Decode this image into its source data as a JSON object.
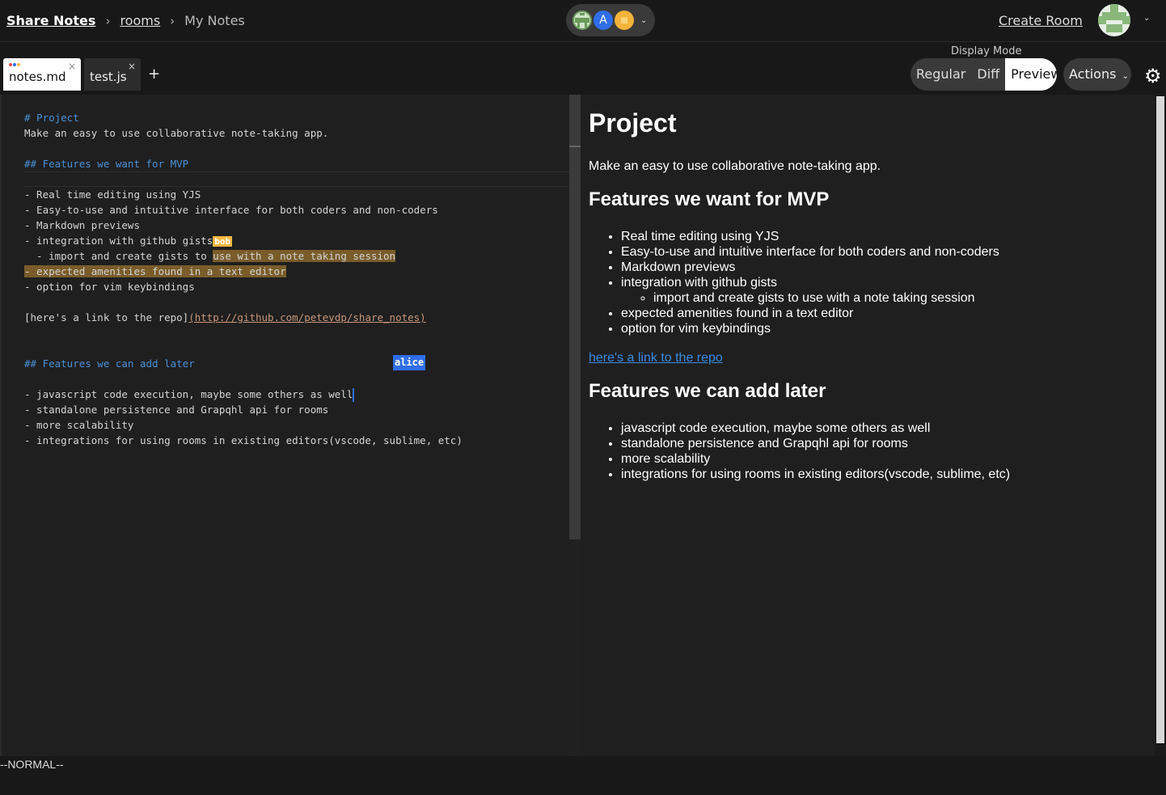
{
  "breadcrumb": {
    "home": "Share Notes",
    "rooms": "rooms",
    "current": "My Notes",
    "sep": "›"
  },
  "users": {
    "avatar_a": "A",
    "chevron": "⌄"
  },
  "header": {
    "create_room": "Create Room",
    "profile_chevron": "⌄"
  },
  "tabs": [
    {
      "label": "notes.md",
      "close": "×",
      "active": true
    },
    {
      "label": "test.js",
      "close": "×",
      "active": false
    }
  ],
  "add_tab": "+",
  "display_mode": {
    "label": "Display Mode",
    "options": [
      "Regular",
      "Diff",
      "Preview"
    ],
    "selected": "Preview"
  },
  "actions": {
    "label": "Actions",
    "chevron": "⌄"
  },
  "editor": {
    "lines": {
      "l1": "# Project",
      "l2": "Make an easy to use collaborative note-taking app.",
      "l4": "## Features we want for MVP",
      "l6": "- Real time editing using YJS",
      "l7": "- Easy-to-use and intuitive interface for both coders and non-coders",
      "l8": "- Markdown previews",
      "l9": "- integration with github gists",
      "l10a": "  - import and create gists to ",
      "l10b": "use with a note taking session",
      "l11": "- expected amenities found in a text editor",
      "l12": "- option for vim keybindings",
      "l14a": "[here's a link to the repo]",
      "l14b": "(http://github.com/petevdp/share_notes)",
      "l17": "## Features we can add later",
      "l19": "- javascript code execution, maybe some others as well",
      "l20": "- standalone persistence and Grapqhl api for rooms",
      "l21": "- more scalability",
      "l22": "- integrations for using rooms in existing editors(vscode, sublime, etc)"
    },
    "cursor_bob": "bob",
    "cursor_alice": "alice"
  },
  "preview": {
    "h1": "Project",
    "intro": "Make an easy to use collaborative note-taking app.",
    "h2a": "Features we want for MVP",
    "mvp": [
      "Real time editing using YJS",
      "Easy-to-use and intuitive interface for both coders and non-coders",
      "Markdown previews",
      "integration with github gists"
    ],
    "mvp_sub": "import and create gists to use with a note taking session",
    "mvp_rest": [
      "expected amenities found in a text editor",
      "option for vim keybindings"
    ],
    "link": "here's a link to the repo",
    "h2b": "Features we can add later",
    "later": [
      "javascript code execution, maybe some others as well",
      "standalone persistence and Grapqhl api for rooms",
      "more scalability",
      "integrations for using rooms in existing editors(vscode, sublime, etc)"
    ]
  },
  "status": "--NORMAL--",
  "colors": {
    "bob": "#f4b942",
    "alice": "#2f6ee8",
    "link": "#3a8be0",
    "heading_md": "#4a90d6"
  }
}
